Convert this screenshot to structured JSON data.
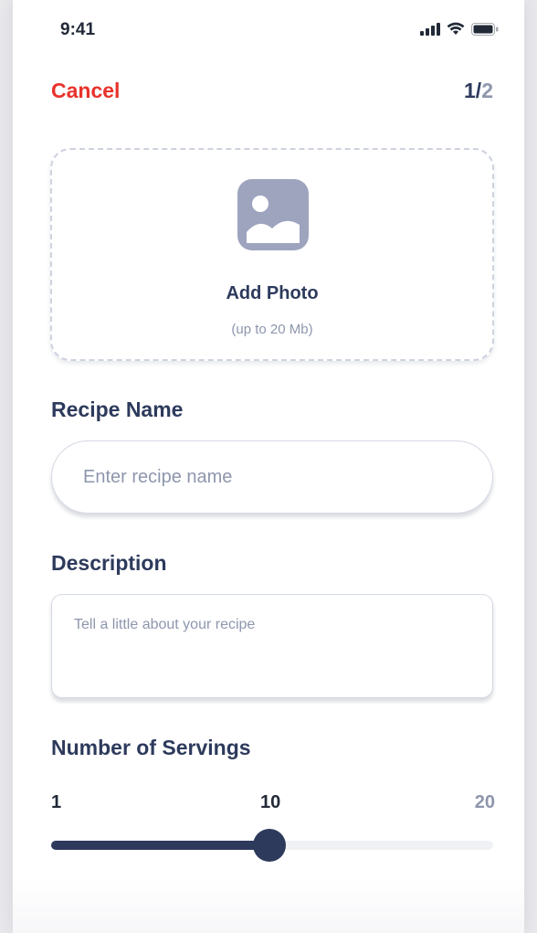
{
  "status_bar": {
    "time": "9:41",
    "icons": [
      "cellular-signal-icon",
      "wifi-icon",
      "battery-icon"
    ]
  },
  "nav": {
    "cancel_label": "Cancel",
    "step_current": "1/",
    "step_total": "2"
  },
  "photo": {
    "icon": "image-icon",
    "title": "Add Photo",
    "subtitle": "(up to 20 Mb)"
  },
  "recipe_name": {
    "label": "Recipe Name",
    "value": "",
    "placeholder": "Enter recipe name"
  },
  "description": {
    "label": "Description",
    "value": "",
    "placeholder": "Tell a little about your recipe"
  },
  "servings": {
    "label": "Number of Servings",
    "min_label": "1",
    "value_label": "10",
    "max_label": "20",
    "min": 1,
    "max": 20,
    "value": 10
  },
  "colors": {
    "accent": "#2d3a5c",
    "cancel": "#e8322a",
    "muted": "#8e96ad",
    "track": "#f0f1f4"
  }
}
